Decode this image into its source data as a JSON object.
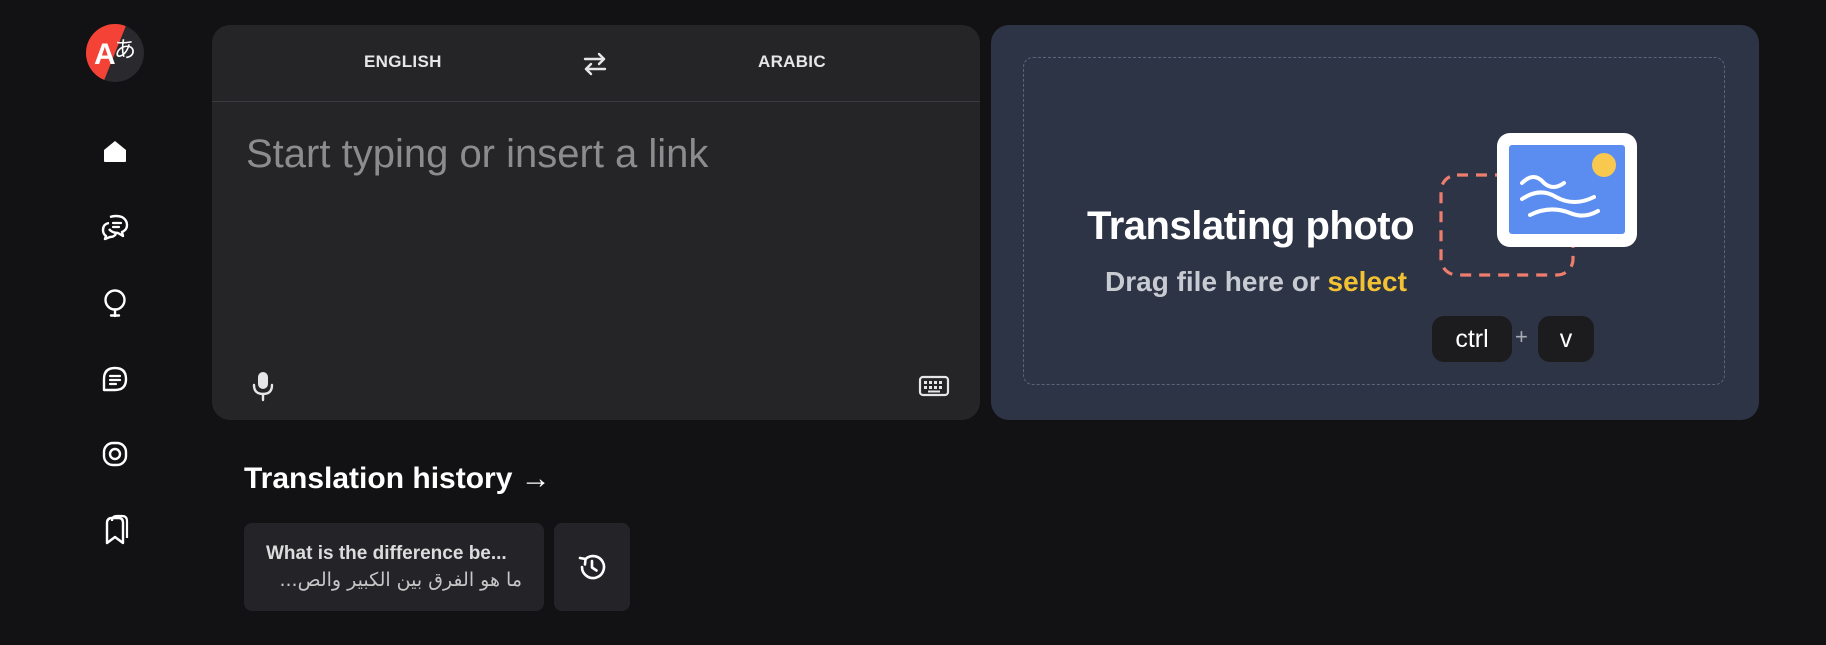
{
  "app": {
    "logo_glyph_latin": "A",
    "logo_glyph_cjk": "あ",
    "accent_color": "#f44336"
  },
  "sidebar": {
    "items": [
      {
        "icon": "home-icon"
      },
      {
        "icon": "chat-bubbles-icon"
      },
      {
        "icon": "lightbulb-icon"
      },
      {
        "icon": "document-text-icon"
      },
      {
        "icon": "camera-icon"
      },
      {
        "icon": "bookmarks-icon"
      }
    ]
  },
  "translator": {
    "source_lang": "ENGLISH",
    "target_lang": "ARABIC",
    "swap_icon": "swap-arrows-icon",
    "placeholder": "Start typing or insert a link",
    "value": "",
    "mic_icon": "microphone-icon",
    "keyboard_icon": "keyboard-icon"
  },
  "photo": {
    "title": "Translating photo",
    "subtitle_prefix": "Drag file here or ",
    "select_label": "select",
    "select_color": "#f3c233",
    "shortcut_ctrl": "ctrl",
    "shortcut_plus": "+",
    "shortcut_v": "v",
    "illustration_icon": "image-icon"
  },
  "history": {
    "title": "Translation history →",
    "items": [
      {
        "source": "What is the difference be...",
        "translation": "ما هو الفرق بين الكبير والص..."
      }
    ],
    "history_icon": "history-clock-icon"
  }
}
